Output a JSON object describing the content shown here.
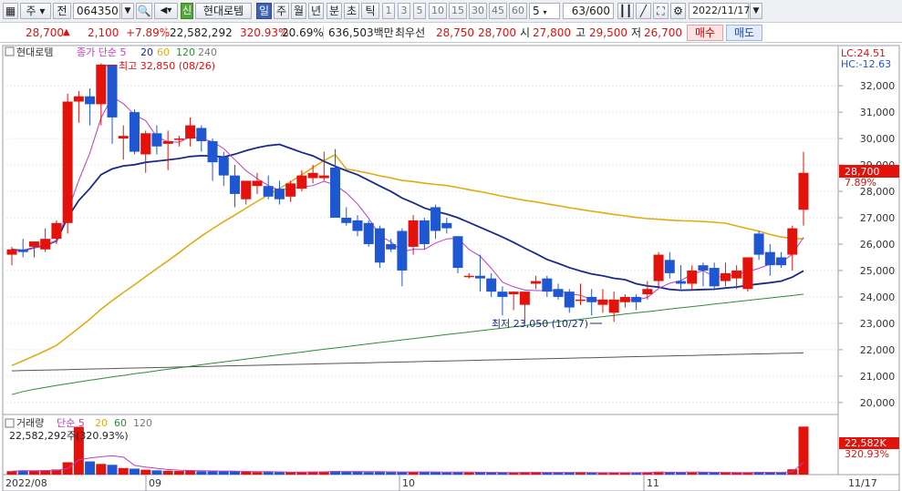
{
  "toolbar": {
    "market": "주",
    "mode": "전",
    "code": "064350",
    "name_badge": "신",
    "name": "현대로템",
    "periods": [
      "일",
      "주",
      "월",
      "년",
      "분",
      "초",
      "틱"
    ],
    "selected_period": "일",
    "intervals": [
      "1",
      "3",
      "5",
      "10",
      "15",
      "30",
      "45",
      "60"
    ],
    "interval_value": "5",
    "count": "63",
    "count_max": "/600",
    "date": "2022/11/17"
  },
  "quote": {
    "price": "28,700",
    "arrow": "▲",
    "change": "2,100",
    "change_pct": "+7.89%",
    "volume": "22,582,292",
    "volume_ratio": "320.93%",
    "turnover": "20.69%",
    "amount": "636,503백만",
    "best_label": "최우선",
    "best_ask": "28,750",
    "best_bid": "28,700",
    "open_label": "시",
    "open": "27,800",
    "high_label": "고",
    "high": "29,500",
    "low_label": "저",
    "low": "26,700",
    "buy_label": "매수",
    "sell_label": "매도"
  },
  "chart": {
    "legend_name": "현대로템",
    "legend_ma_title": "종가 단순 5",
    "legend_ma": [
      "20",
      "60",
      "120",
      "240"
    ],
    "lc": "LC:24.51",
    "hc": "HC:-12.63",
    "high_annotation": "최고 32,850 (08/26)",
    "low_annotation": "최저 23,050 (10/27)",
    "price_tag": "28,700",
    "price_tag_pct": "7.89%",
    "volume_title": "거래량",
    "volume_ma_title": "단순 5",
    "volume_ma": [
      "20",
      "60",
      "120"
    ],
    "volume_readout": "22,582,292주(320.93%)",
    "volume_tag": "22,582K",
    "volume_tag_pct": "320.93%",
    "date_labels": [
      "2022/08",
      "09",
      "10",
      "11",
      "11/17"
    ]
  },
  "colors": {
    "up": "#e3120b",
    "down": "#1f57d3",
    "ma5": "#c23bc2",
    "ma20": "#1b2a8a",
    "ma60": "#e0ac12",
    "ma120": "#2e8a3a",
    "ma240": "#555555"
  },
  "chart_data": {
    "type": "candlestick",
    "y_ticks": [
      32000,
      31000,
      30000,
      29000,
      28000,
      27000,
      26000,
      25000,
      24000,
      23000,
      22000,
      21000,
      20000
    ],
    "ylim": [
      19650,
      33350
    ],
    "candles": [
      {
        "o": 25600,
        "h": 25900,
        "l": 25200,
        "c": 25800
      },
      {
        "o": 25800,
        "h": 26200,
        "l": 25500,
        "c": 25700
      },
      {
        "o": 25900,
        "h": 26000,
        "l": 25500,
        "c": 26100
      },
      {
        "o": 25800,
        "h": 26600,
        "l": 25700,
        "c": 26200
      },
      {
        "o": 26200,
        "h": 26900,
        "l": 26000,
        "c": 26800
      },
      {
        "o": 26800,
        "h": 31700,
        "l": 26400,
        "c": 31400
      },
      {
        "o": 31400,
        "h": 31800,
        "l": 30600,
        "c": 31600
      },
      {
        "o": 31600,
        "h": 31900,
        "l": 30500,
        "c": 31300
      },
      {
        "o": 31300,
        "h": 32850,
        "l": 30500,
        "c": 32800
      },
      {
        "o": 32800,
        "h": 32800,
        "l": 29800,
        "c": 30800
      },
      {
        "o": 30000,
        "h": 30500,
        "l": 29200,
        "c": 30100
      },
      {
        "o": 31000,
        "h": 31100,
        "l": 29400,
        "c": 29500
      },
      {
        "o": 29400,
        "h": 30300,
        "l": 28700,
        "c": 30200
      },
      {
        "o": 30200,
        "h": 30500,
        "l": 29400,
        "c": 29700
      },
      {
        "o": 29800,
        "h": 30300,
        "l": 28800,
        "c": 29900
      },
      {
        "o": 30000,
        "h": 30100,
        "l": 29700,
        "c": 30000
      },
      {
        "o": 30000,
        "h": 30800,
        "l": 29700,
        "c": 30500
      },
      {
        "o": 30400,
        "h": 30500,
        "l": 29500,
        "c": 29900
      },
      {
        "o": 29900,
        "h": 30000,
        "l": 28400,
        "c": 29100
      },
      {
        "o": 29300,
        "h": 29500,
        "l": 28200,
        "c": 28600
      },
      {
        "o": 28600,
        "h": 29000,
        "l": 27400,
        "c": 27900
      },
      {
        "o": 27700,
        "h": 28200,
        "l": 27500,
        "c": 28400
      },
      {
        "o": 28200,
        "h": 28700,
        "l": 27900,
        "c": 28400
      },
      {
        "o": 28200,
        "h": 28600,
        "l": 27700,
        "c": 27800
      },
      {
        "o": 28100,
        "h": 28400,
        "l": 27500,
        "c": 27700
      },
      {
        "o": 27800,
        "h": 28400,
        "l": 27600,
        "c": 28300
      },
      {
        "o": 28100,
        "h": 28800,
        "l": 28000,
        "c": 28600
      },
      {
        "o": 28500,
        "h": 29000,
        "l": 28300,
        "c": 28700
      },
      {
        "o": 28500,
        "h": 29500,
        "l": 28400,
        "c": 28600
      },
      {
        "o": 28900,
        "h": 29600,
        "l": 27200,
        "c": 27000
      },
      {
        "o": 27000,
        "h": 27400,
        "l": 26700,
        "c": 26800
      },
      {
        "o": 26900,
        "h": 27100,
        "l": 26300,
        "c": 26500
      },
      {
        "o": 26800,
        "h": 26900,
        "l": 25900,
        "c": 26000
      },
      {
        "o": 26600,
        "h": 26700,
        "l": 25100,
        "c": 25300
      },
      {
        "o": 26000,
        "h": 26200,
        "l": 25700,
        "c": 25800
      },
      {
        "o": 26500,
        "h": 26600,
        "l": 24400,
        "c": 25000
      },
      {
        "o": 25900,
        "h": 27100,
        "l": 25600,
        "c": 26900
      },
      {
        "o": 26900,
        "h": 27000,
        "l": 25800,
        "c": 26000
      },
      {
        "o": 27400,
        "h": 27500,
        "l": 26200,
        "c": 26500
      },
      {
        "o": 26800,
        "h": 27000,
        "l": 26400,
        "c": 26600
      },
      {
        "o": 26300,
        "h": 26300,
        "l": 24900,
        "c": 25100
      },
      {
        "o": 24800,
        "h": 24900,
        "l": 24700,
        "c": 24800
      },
      {
        "o": 24800,
        "h": 25600,
        "l": 24200,
        "c": 24700
      },
      {
        "o": 24700,
        "h": 24900,
        "l": 24000,
        "c": 24200
      },
      {
        "o": 24200,
        "h": 24400,
        "l": 23300,
        "c": 24000
      },
      {
        "o": 24100,
        "h": 24200,
        "l": 23500,
        "c": 24200
      },
      {
        "o": 23700,
        "h": 24200,
        "l": 23000,
        "c": 24200
      },
      {
        "o": 24500,
        "h": 24800,
        "l": 24300,
        "c": 24600
      },
      {
        "o": 24700,
        "h": 24800,
        "l": 24000,
        "c": 24200
      },
      {
        "o": 24300,
        "h": 24500,
        "l": 23900,
        "c": 24000
      },
      {
        "o": 24200,
        "h": 24300,
        "l": 23400,
        "c": 23600
      },
      {
        "o": 23900,
        "h": 24500,
        "l": 23700,
        "c": 23900
      },
      {
        "o": 24000,
        "h": 24300,
        "l": 23300,
        "c": 23800
      },
      {
        "o": 23700,
        "h": 24300,
        "l": 23400,
        "c": 23900
      },
      {
        "o": 23400,
        "h": 24200,
        "l": 23050,
        "c": 23900
      },
      {
        "o": 23800,
        "h": 24100,
        "l": 23600,
        "c": 24000
      },
      {
        "o": 24000,
        "h": 24100,
        "l": 23500,
        "c": 23800
      },
      {
        "o": 24100,
        "h": 24600,
        "l": 23900,
        "c": 24300
      },
      {
        "o": 24600,
        "h": 25700,
        "l": 24400,
        "c": 25600
      },
      {
        "o": 25400,
        "h": 25700,
        "l": 24700,
        "c": 24900
      },
      {
        "o": 24600,
        "h": 25200,
        "l": 24300,
        "c": 24500
      },
      {
        "o": 24500,
        "h": 25200,
        "l": 24300,
        "c": 25000
      },
      {
        "o": 25200,
        "h": 25300,
        "l": 24400,
        "c": 25000
      },
      {
        "o": 25100,
        "h": 25300,
        "l": 24300,
        "c": 24400
      },
      {
        "o": 24600,
        "h": 25300,
        "l": 24400,
        "c": 24900
      },
      {
        "o": 24700,
        "h": 25200,
        "l": 24300,
        "c": 25000
      },
      {
        "o": 24300,
        "h": 25000,
        "l": 24200,
        "c": 25500
      },
      {
        "o": 26400,
        "h": 26500,
        "l": 25400,
        "c": 25600
      },
      {
        "o": 25700,
        "h": 26000,
        "l": 24800,
        "c": 25200
      },
      {
        "o": 25500,
        "h": 25700,
        "l": 25100,
        "c": 25200
      },
      {
        "o": 25600,
        "h": 26700,
        "l": 25000,
        "c": 26600
      },
      {
        "o": 27300,
        "h": 29500,
        "l": 26700,
        "c": 28700
      }
    ],
    "volumes": [
      1.6,
      2.0,
      1.8,
      2.1,
      2.4,
      5.8,
      22.5,
      6.2,
      5.0,
      4.6,
      3.1,
      2.8,
      2.3,
      2.0,
      1.8,
      1.7,
      1.9,
      1.6,
      1.5,
      1.6,
      1.5,
      1.3,
      1.2,
      1.3,
      1.2,
      1.1,
      1.3,
      1.4,
      1.5,
      1.7,
      1.4,
      1.3,
      1.2,
      1.4,
      1.1,
      1.3,
      1.2,
      1.4,
      1.2,
      1.0,
      1.2,
      1.0,
      1.1,
      1.0,
      0.9,
      1.0,
      1.1,
      1.2,
      1.0,
      0.9,
      1.0,
      1.0,
      0.9,
      0.8,
      0.9,
      1.0,
      0.9,
      1.1,
      1.4,
      1.2,
      1.0,
      1.0,
      1.1,
      1.0,
      1.0,
      0.9,
      1.0,
      1.3,
      1.1,
      0.9,
      2.5,
      22.58
    ],
    "volume_ylim": [
      0,
      24
    ],
    "ma240_start": 21200,
    "ma240_end": 21880,
    "ma120_start": 20300,
    "ma120_end": 24100
  }
}
